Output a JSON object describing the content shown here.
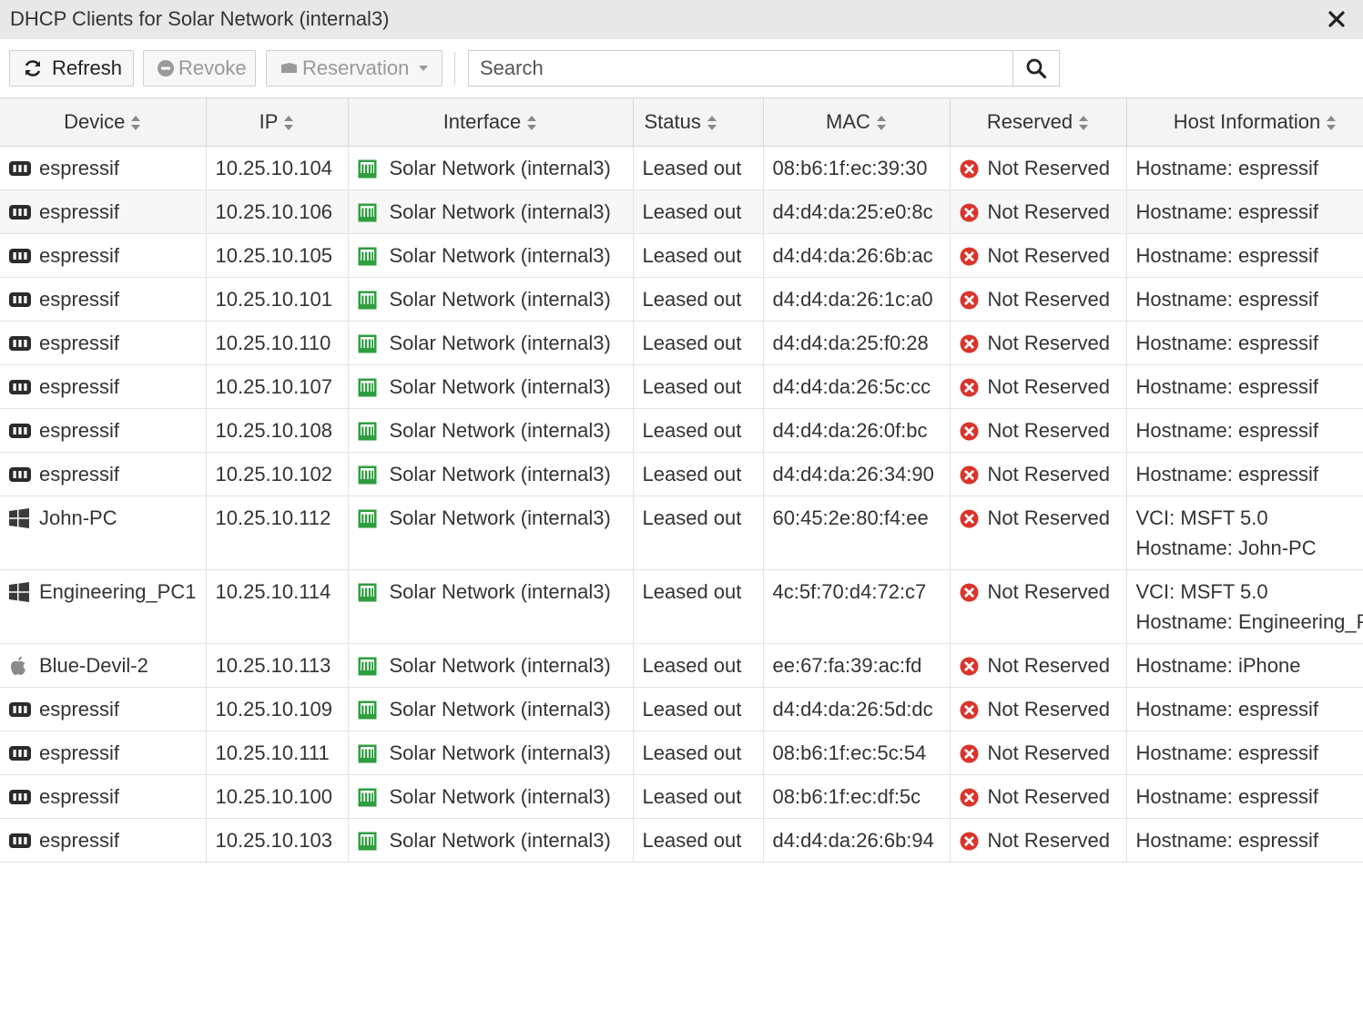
{
  "window": {
    "title": "DHCP Clients for Solar Network (internal3)"
  },
  "toolbar": {
    "refresh_label": "Refresh",
    "revoke_label": "Revoke",
    "reservation_label": "Reservation",
    "search_placeholder": "Search"
  },
  "columns": {
    "device": "Device",
    "ip": "IP",
    "interface": "Interface",
    "status": "Status",
    "mac": "MAC",
    "reserved": "Reserved",
    "host": "Host Information"
  },
  "colors": {
    "interface_icon": "#2e9e3e",
    "not_reserved_icon": "#d9352c",
    "header_bg": "#f4f4f4",
    "titlebar_bg": "#e8e8e8"
  },
  "rows": [
    {
      "device_icon": "device-icon",
      "device": "espressif",
      "ip": "10.25.10.104",
      "interface": "Solar Network (internal3)",
      "status": "Leased out",
      "mac": "08:b6:1f:ec:39:30",
      "reserved": "Not Reserved",
      "host": [
        "Hostname: espressif"
      ]
    },
    {
      "device_icon": "device-icon",
      "device": "espressif",
      "ip": "10.25.10.106",
      "interface": "Solar Network (internal3)",
      "status": "Leased out",
      "mac": "d4:d4:da:25:e0:8c",
      "reserved": "Not Reserved",
      "host": [
        "Hostname: espressif"
      ]
    },
    {
      "device_icon": "device-icon",
      "device": "espressif",
      "ip": "10.25.10.105",
      "interface": "Solar Network (internal3)",
      "status": "Leased out",
      "mac": "d4:d4:da:26:6b:ac",
      "reserved": "Not Reserved",
      "host": [
        "Hostname: espressif"
      ]
    },
    {
      "device_icon": "device-icon",
      "device": "espressif",
      "ip": "10.25.10.101",
      "interface": "Solar Network (internal3)",
      "status": "Leased out",
      "mac": "d4:d4:da:26:1c:a0",
      "reserved": "Not Reserved",
      "host": [
        "Hostname: espressif"
      ]
    },
    {
      "device_icon": "device-icon",
      "device": "espressif",
      "ip": "10.25.10.110",
      "interface": "Solar Network (internal3)",
      "status": "Leased out",
      "mac": "d4:d4:da:25:f0:28",
      "reserved": "Not Reserved",
      "host": [
        "Hostname: espressif"
      ]
    },
    {
      "device_icon": "device-icon",
      "device": "espressif",
      "ip": "10.25.10.107",
      "interface": "Solar Network (internal3)",
      "status": "Leased out",
      "mac": "d4:d4:da:26:5c:cc",
      "reserved": "Not Reserved",
      "host": [
        "Hostname: espressif"
      ]
    },
    {
      "device_icon": "device-icon",
      "device": "espressif",
      "ip": "10.25.10.108",
      "interface": "Solar Network (internal3)",
      "status": "Leased out",
      "mac": "d4:d4:da:26:0f:bc",
      "reserved": "Not Reserved",
      "host": [
        "Hostname: espressif"
      ]
    },
    {
      "device_icon": "device-icon",
      "device": "espressif",
      "ip": "10.25.10.102",
      "interface": "Solar Network (internal3)",
      "status": "Leased out",
      "mac": "d4:d4:da:26:34:90",
      "reserved": "Not Reserved",
      "host": [
        "Hostname: espressif"
      ]
    },
    {
      "device_icon": "windows-icon",
      "device": "John-PC",
      "ip": "10.25.10.112",
      "interface": "Solar Network (internal3)",
      "status": "Leased out",
      "mac": "60:45:2e:80:f4:ee",
      "reserved": "Not Reserved",
      "host": [
        "VCI: MSFT 5.0",
        "Hostname: John-PC"
      ]
    },
    {
      "device_icon": "windows-icon",
      "device": "Engineering_PC1",
      "ip": "10.25.10.114",
      "interface": "Solar Network (internal3)",
      "status": "Leased out",
      "mac": "4c:5f:70:d4:72:c7",
      "reserved": "Not Reserved",
      "host": [
        "VCI: MSFT 5.0",
        "Hostname: Engineering_P"
      ]
    },
    {
      "device_icon": "apple-icon",
      "device": "Blue-Devil-2",
      "ip": "10.25.10.113",
      "interface": "Solar Network (internal3)",
      "status": "Leased out",
      "mac": "ee:67:fa:39:ac:fd",
      "reserved": "Not Reserved",
      "host": [
        "Hostname: iPhone"
      ]
    },
    {
      "device_icon": "device-icon",
      "device": "espressif",
      "ip": "10.25.10.109",
      "interface": "Solar Network (internal3)",
      "status": "Leased out",
      "mac": "d4:d4:da:26:5d:dc",
      "reserved": "Not Reserved",
      "host": [
        "Hostname: espressif"
      ]
    },
    {
      "device_icon": "device-icon",
      "device": "espressif",
      "ip": "10.25.10.111",
      "interface": "Solar Network (internal3)",
      "status": "Leased out",
      "mac": "08:b6:1f:ec:5c:54",
      "reserved": "Not Reserved",
      "host": [
        "Hostname: espressif"
      ]
    },
    {
      "device_icon": "device-icon",
      "device": "espressif",
      "ip": "10.25.10.100",
      "interface": "Solar Network (internal3)",
      "status": "Leased out",
      "mac": "08:b6:1f:ec:df:5c",
      "reserved": "Not Reserved",
      "host": [
        "Hostname: espressif"
      ]
    },
    {
      "device_icon": "device-icon",
      "device": "espressif",
      "ip": "10.25.10.103",
      "interface": "Solar Network (internal3)",
      "status": "Leased out",
      "mac": "d4:d4:da:26:6b:94",
      "reserved": "Not Reserved",
      "host": [
        "Hostname: espressif"
      ]
    }
  ]
}
